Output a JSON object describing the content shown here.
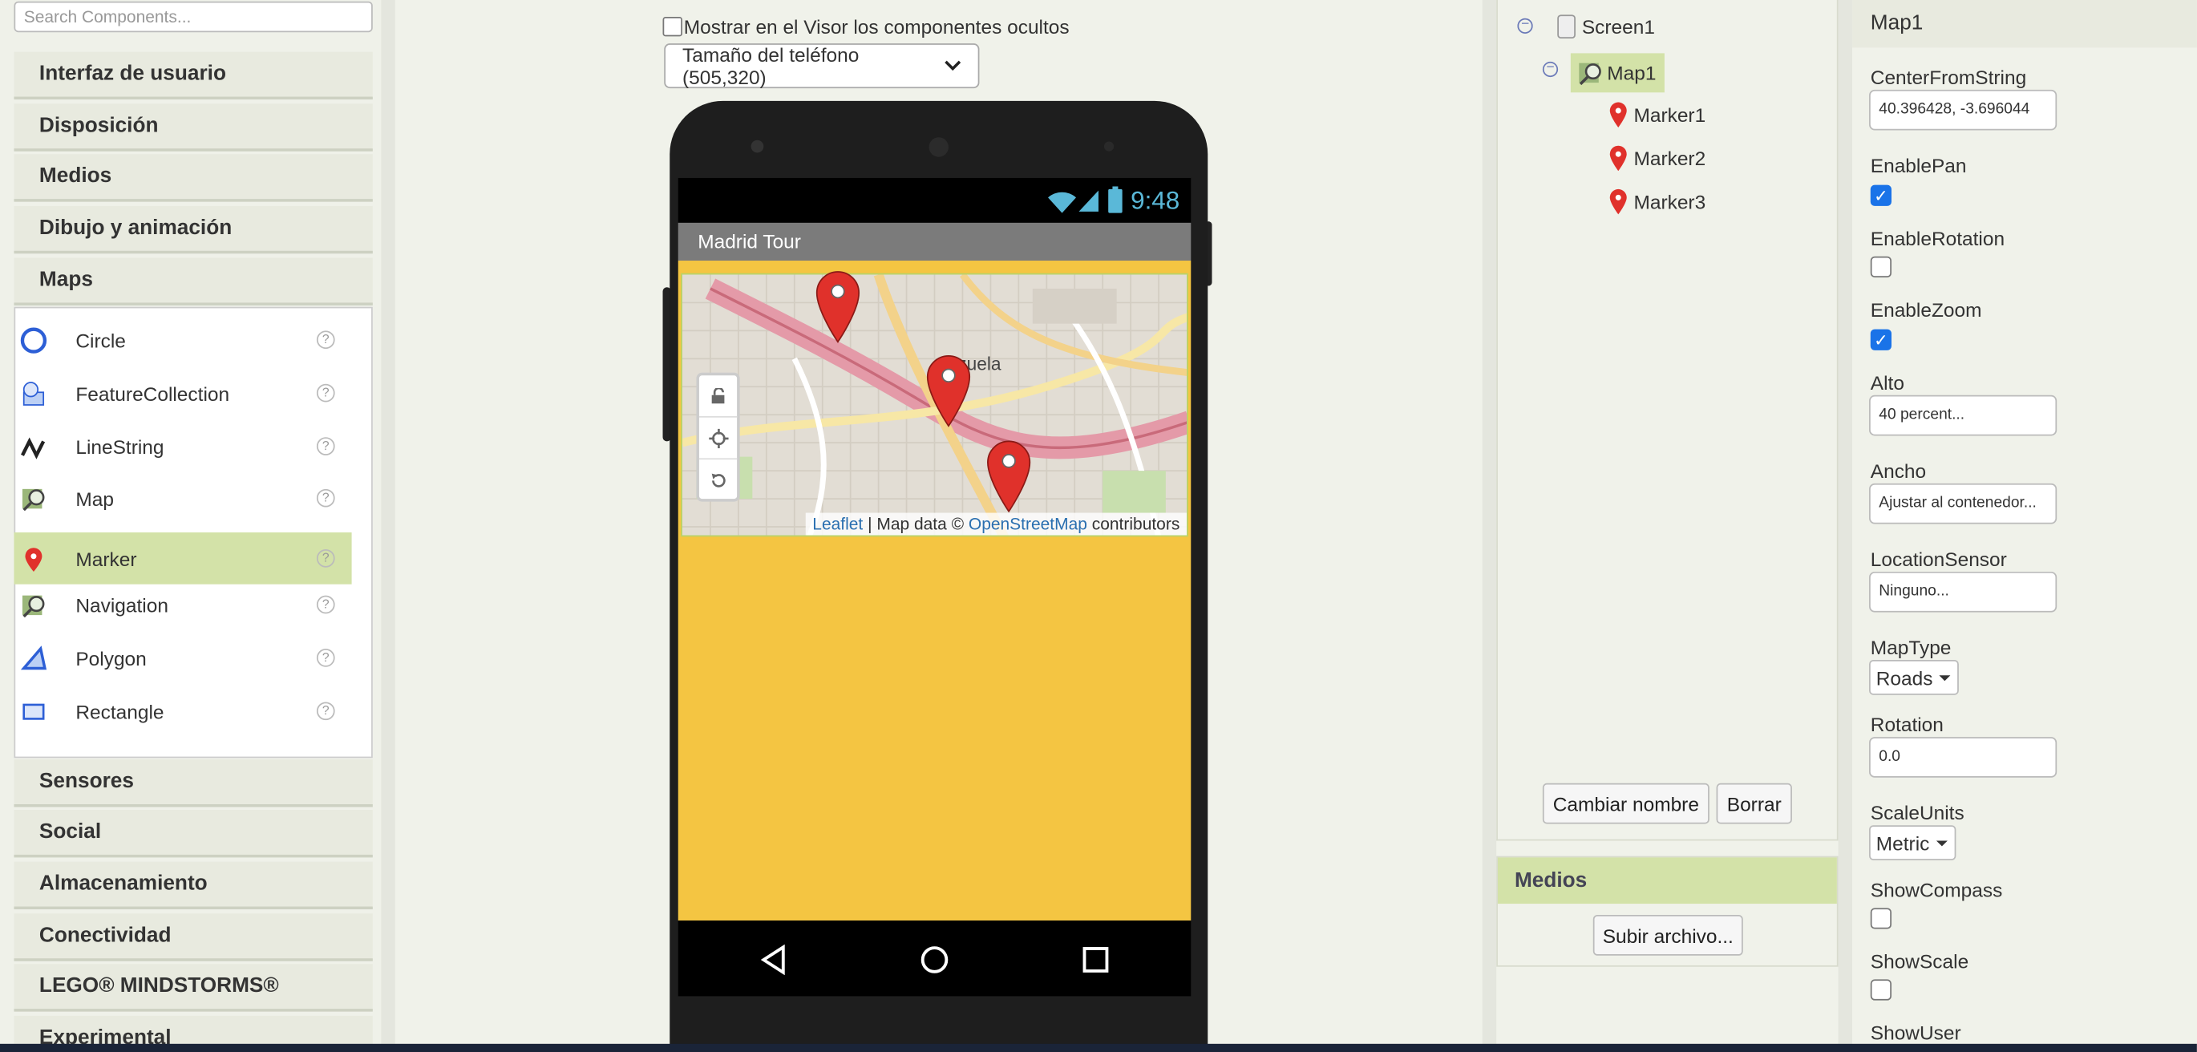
{
  "palette": {
    "search_placeholder": "Search Components...",
    "categories_top": [
      "Interfaz de usuario",
      "Disposición",
      "Medios",
      "Dibujo y animación",
      "Maps"
    ],
    "maps_items": [
      {
        "label": "Circle",
        "icon": "circle-icon"
      },
      {
        "label": "FeatureCollection",
        "icon": "feature-collection-icon"
      },
      {
        "label": "LineString",
        "icon": "linestring-icon"
      },
      {
        "label": "Map",
        "icon": "map-icon"
      },
      {
        "label": "Marker",
        "icon": "marker-icon",
        "selected": true
      },
      {
        "label": "Navigation",
        "icon": "navigation-icon"
      },
      {
        "label": "Polygon",
        "icon": "polygon-icon"
      },
      {
        "label": "Rectangle",
        "icon": "rectangle-icon"
      }
    ],
    "help_glyph": "?",
    "categories_bottom": [
      "Sensores",
      "Social",
      "Almacenamiento",
      "Conectividad",
      "LEGO® MINDSTORMS®",
      "Experimental"
    ]
  },
  "viewer": {
    "show_hidden_label": "Mostrar en el Visor los componentes ocultos",
    "phone_size_select": "Tamaño del teléfono (505,320)",
    "status_time": "9:48",
    "screen_title": "Madrid Tour",
    "map_place_label": "anzuela",
    "map_attribution": {
      "leaflet": "Leaflet",
      "mid": " | Map data © ",
      "osm": "OpenStreetMap",
      "end": " contributors"
    },
    "screen_color": "#f4c542",
    "title_bar_color": "#7b7b7b"
  },
  "components": {
    "tree": [
      {
        "label": "Screen1",
        "icon": "screen-icon"
      },
      {
        "label": "Map1",
        "icon": "map-icon",
        "selected": true
      },
      {
        "label": "Marker1",
        "icon": "marker-icon"
      },
      {
        "label": "Marker2",
        "icon": "marker-icon"
      },
      {
        "label": "Marker3",
        "icon": "marker-icon"
      }
    ],
    "rename_button": "Cambiar nombre",
    "delete_button": "Borrar"
  },
  "media": {
    "title": "Medios",
    "upload_button": "Subir archivo..."
  },
  "properties": {
    "title": "Map1",
    "center_label": "CenterFromString",
    "center_value": "40.396428, -3.696044",
    "enable_pan_label": "EnablePan",
    "enable_pan": true,
    "enable_rotation_label": "EnableRotation",
    "enable_rotation": false,
    "enable_zoom_label": "EnableZoom",
    "enable_zoom": true,
    "height_label": "Alto",
    "height_value": "40 percent...",
    "width_label": "Ancho",
    "width_value": "Ajustar al contenedor...",
    "location_sensor_label": "LocationSensor",
    "location_sensor_value": "Ninguno...",
    "map_type_label": "MapType",
    "map_type_value": "Roads",
    "rotation_label": "Rotation",
    "rotation_value": "0.0",
    "scale_units_label": "ScaleUnits",
    "scale_units_value": "Metric",
    "show_compass_label": "ShowCompass",
    "show_compass": false,
    "show_scale_label": "ShowScale",
    "show_scale": false,
    "show_user_label": "ShowUser"
  }
}
